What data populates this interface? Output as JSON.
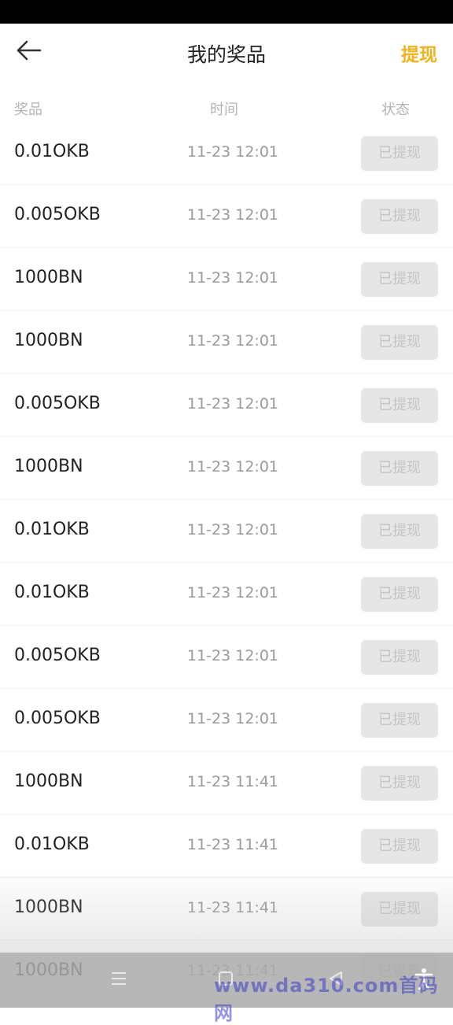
{
  "header": {
    "title": "我的奖品",
    "withdraw_label": "提现"
  },
  "columns": {
    "prize": "奖品",
    "time": "时间",
    "status": "状态"
  },
  "rows": [
    {
      "prize": "0.01OKB",
      "time": "11-23 12:01",
      "status": "已提现"
    },
    {
      "prize": "0.005OKB",
      "time": "11-23 12:01",
      "status": "已提现"
    },
    {
      "prize": "1000BN",
      "time": "11-23 12:01",
      "status": "已提现"
    },
    {
      "prize": "1000BN",
      "time": "11-23 12:01",
      "status": "已提现"
    },
    {
      "prize": "0.005OKB",
      "time": "11-23 12:01",
      "status": "已提现"
    },
    {
      "prize": "1000BN",
      "time": "11-23 12:01",
      "status": "已提现"
    },
    {
      "prize": "0.01OKB",
      "time": "11-23 12:01",
      "status": "已提现"
    },
    {
      "prize": "0.01OKB",
      "time": "11-23 12:01",
      "status": "已提现"
    },
    {
      "prize": "0.005OKB",
      "time": "11-23 12:01",
      "status": "已提现"
    },
    {
      "prize": "0.005OKB",
      "time": "11-23 12:01",
      "status": "已提现"
    },
    {
      "prize": "1000BN",
      "time": "11-23 11:41",
      "status": "已提现"
    },
    {
      "prize": "0.01OKB",
      "time": "11-23 11:41",
      "status": "已提现"
    },
    {
      "prize": "1000BN",
      "time": "11-23 11:41",
      "status": "已提现"
    },
    {
      "prize": "1000BN",
      "time": "11-23 11:41",
      "status": "已提现"
    }
  ],
  "watermark": "www.da310.com首码网",
  "colors": {
    "accent": "#f2b21c",
    "status_bg": "#e6e6e6",
    "status_text": "#c4c4c4"
  },
  "icons": {
    "back": "arrow-left-icon",
    "nav_menu": "menu-icon",
    "nav_home": "home-icon",
    "nav_back": "triangle-back-icon",
    "nav_access": "accessibility-icon"
  }
}
